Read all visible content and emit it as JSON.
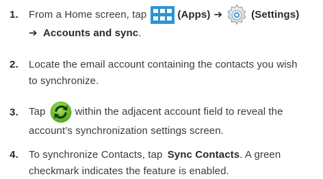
{
  "steps": [
    {
      "number": "1.",
      "line1": {
        "text_a": "From a Home screen, tap",
        "apps_label": "(Apps)",
        "arrow": "➔",
        "settings_label": "(Settings)"
      },
      "line2": {
        "arrow": "➔",
        "bold": "Accounts and sync",
        "end": "."
      }
    },
    {
      "number": "2.",
      "line1": "Locate the email account containing the contacts you wish",
      "line2": "to synchronize."
    },
    {
      "number": "3.",
      "line1": {
        "text_a": "Tap",
        "text_b": "within the adjacent account field to reveal the"
      },
      "line2": "account’s synchronization settings screen."
    },
    {
      "number": "4.",
      "line1": {
        "text_a": "To synchronize Contacts, tap",
        "bold": "Sync Contacts",
        "text_b": ". A green"
      },
      "line2": "checkmark indicates the feature is enabled."
    }
  ],
  "icons": {
    "apps": "apps-grid-icon",
    "settings": "gear-icon",
    "sync": "sync-icon"
  },
  "colors": {
    "apps_blue": "#2b95d8",
    "sync_green": "#6cc52c",
    "text": "#3a3a3a"
  }
}
